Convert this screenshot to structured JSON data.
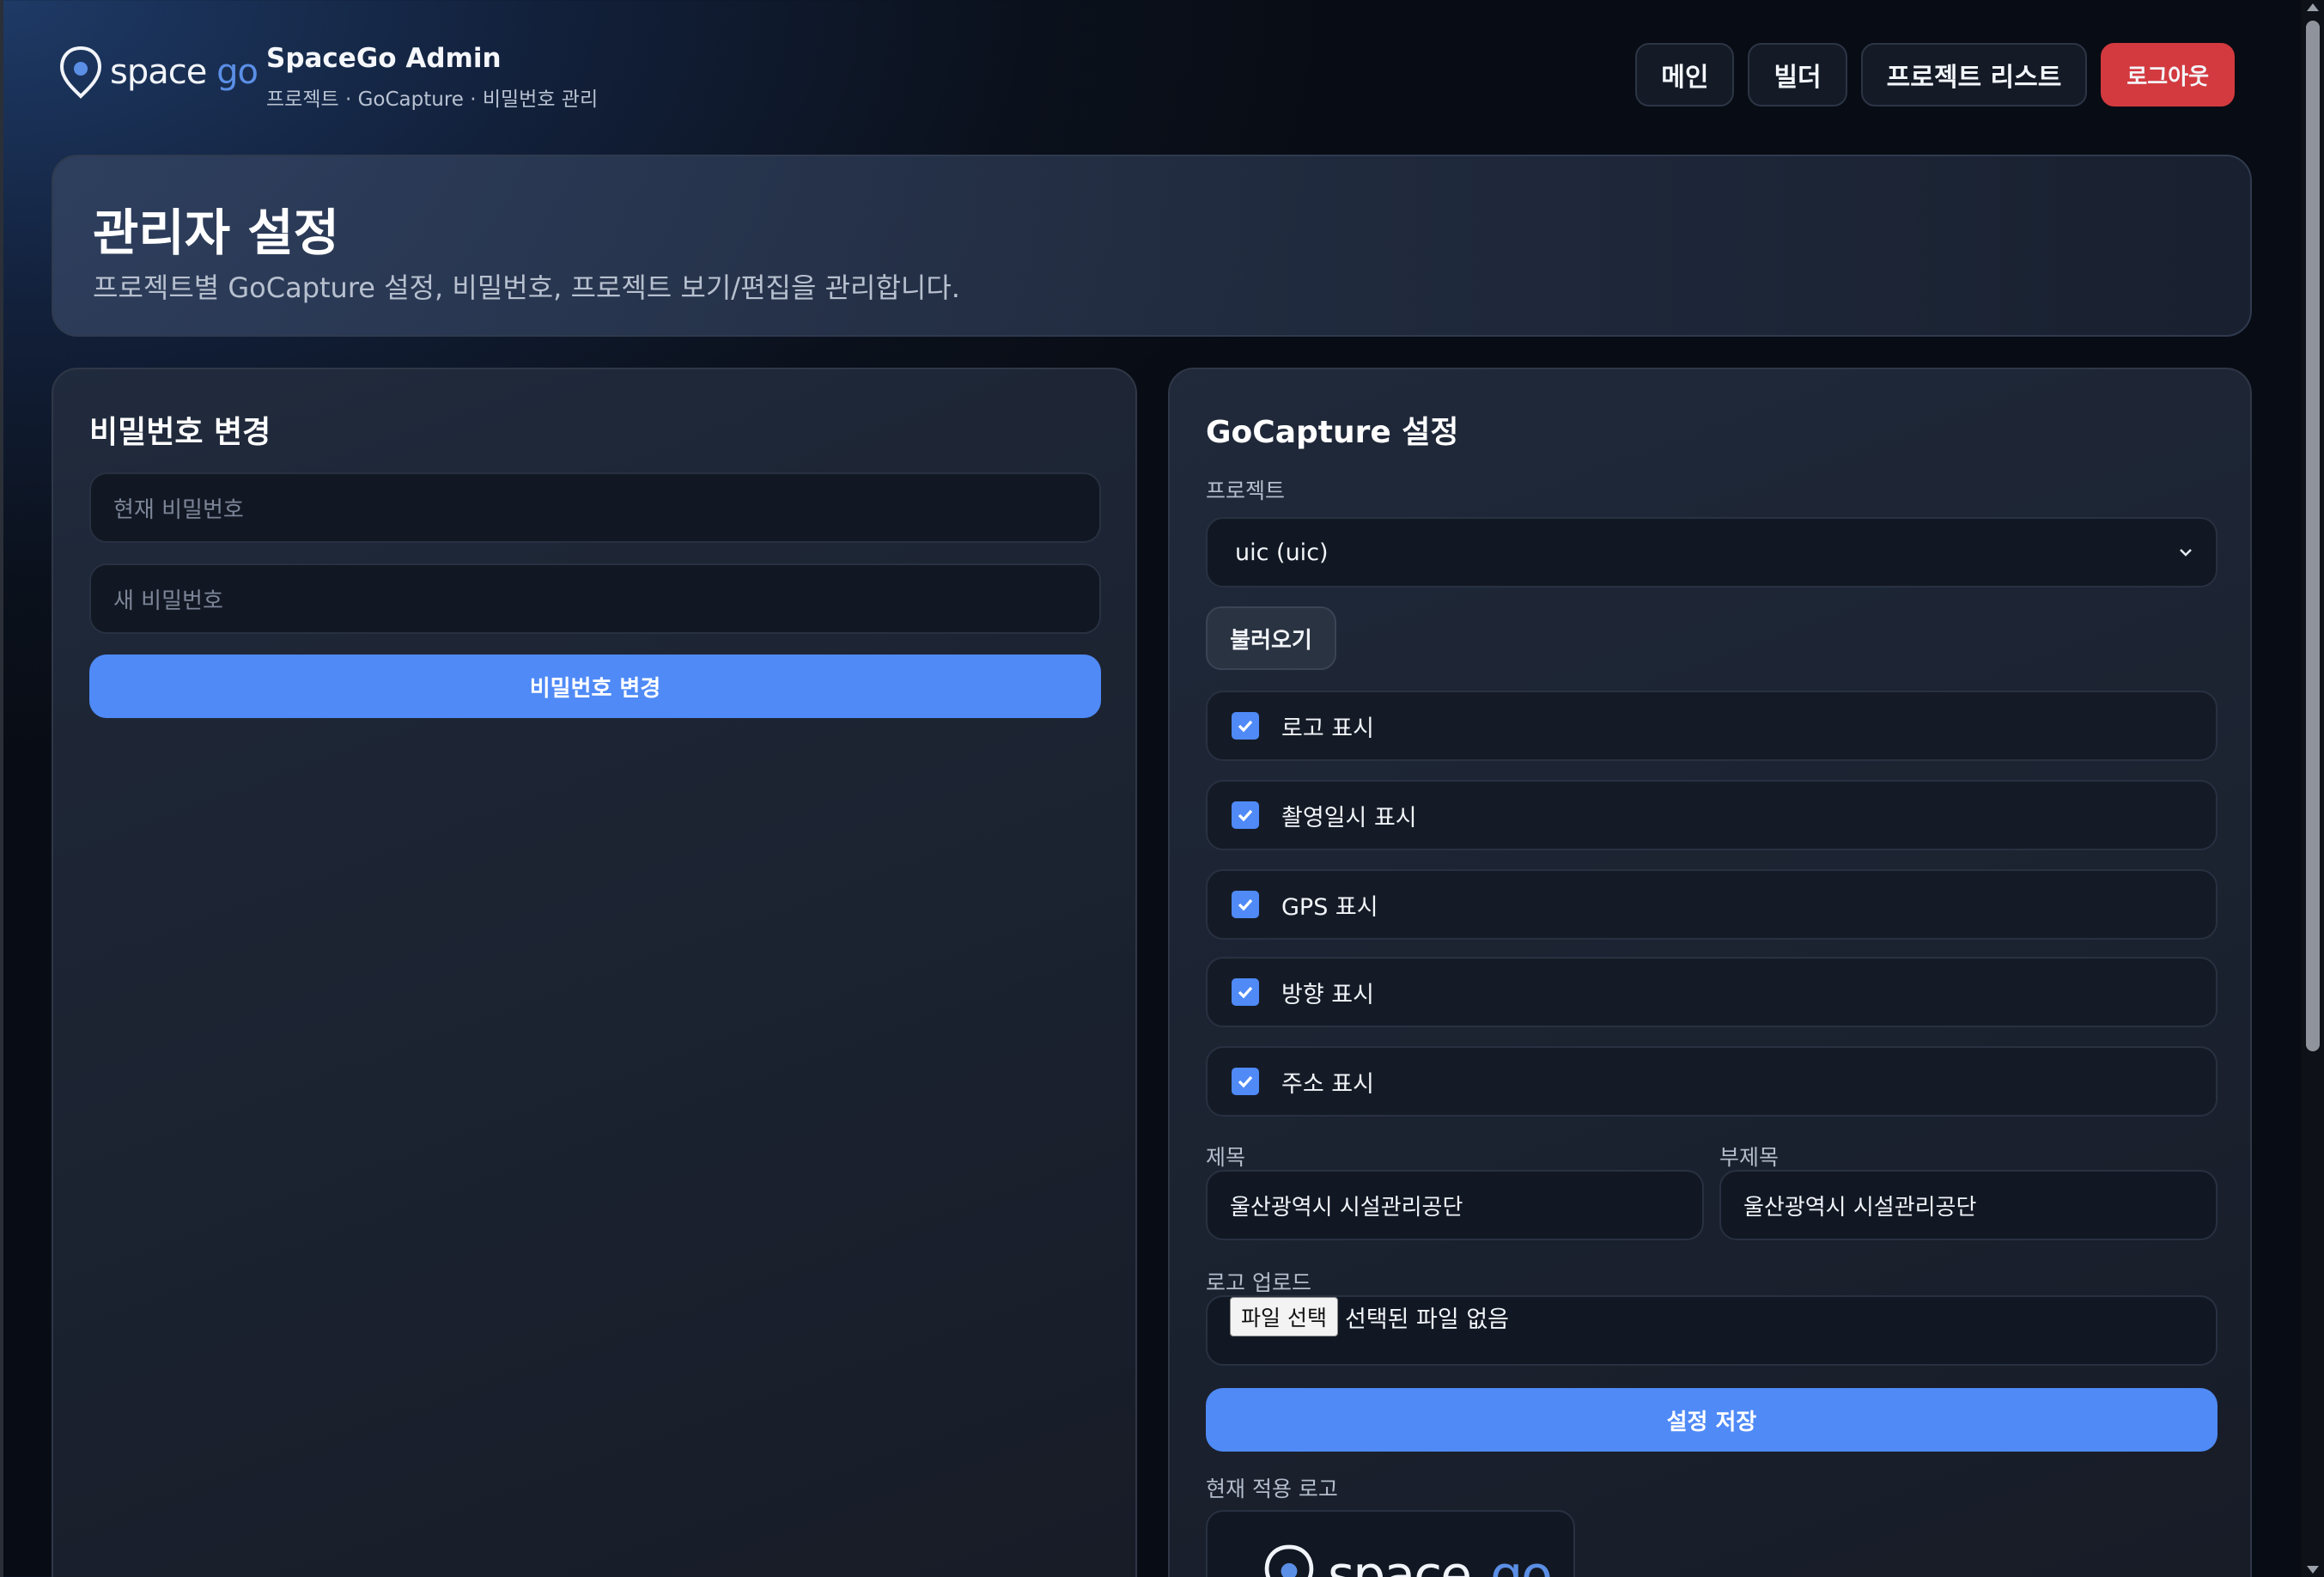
{
  "header": {
    "brand_word": "space",
    "brand_word_accent": "go",
    "title": "SpaceGo Admin",
    "breadcrumb": "프로젝트 · GoCapture · 비밀번호 관리",
    "nav": {
      "main": "메인",
      "builder": "빌더",
      "project_list": "프로젝트 리스트",
      "logout": "로그아웃"
    }
  },
  "hero": {
    "title": "관리자 설정",
    "subtitle": "프로젝트별 GoCapture 설정, 비밀번호, 프로젝트 보기/편집을 관리합니다."
  },
  "password_panel": {
    "title": "비밀번호 변경",
    "current_placeholder": "현재 비밀번호",
    "new_placeholder": "새 비밀번호",
    "submit": "비밀번호 변경"
  },
  "gocapture_panel": {
    "title": "GoCapture 설정",
    "project_label": "프로젝트",
    "project_selected": "uic (uic)",
    "load_button": "불러오기",
    "options": [
      {
        "label": "로고 표시",
        "checked": true
      },
      {
        "label": "촬영일시 표시",
        "checked": true
      },
      {
        "label": "GPS 표시",
        "checked": true
      },
      {
        "label": "방향 표시",
        "checked": true
      },
      {
        "label": "주소 표시",
        "checked": true
      }
    ],
    "title_label": "제목",
    "title_value": "울산광역시 시설관리공단",
    "subtitle_label": "부제목",
    "subtitle_value": "울산광역시 시설관리공단",
    "logo_upload_label": "로고 업로드",
    "file_button": "파일 선택",
    "file_status": "선택된 파일 없음",
    "save_button": "설정 저장",
    "current_logo_label": "현재 적용 로고"
  },
  "colors": {
    "accent": "#4f8af7",
    "danger": "#d33a3f",
    "brand_go": "#5b8fe6"
  }
}
